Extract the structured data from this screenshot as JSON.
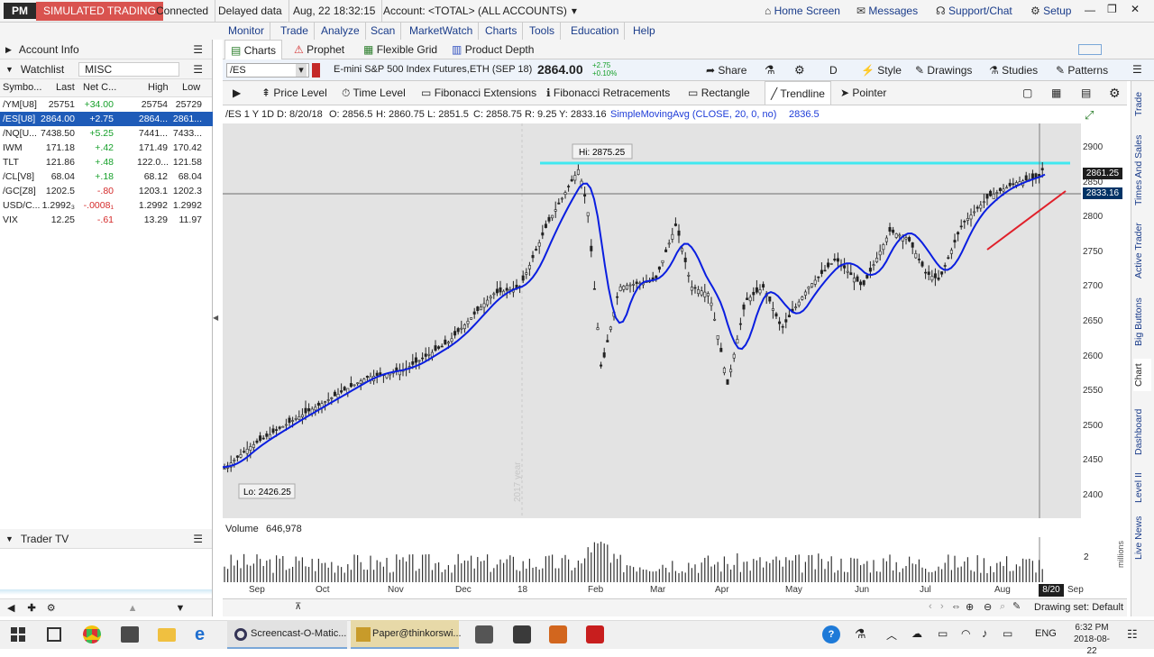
{
  "titlebar": {
    "logo": "PM",
    "mode": "SIMULATED TRADING",
    "status": "Connected",
    "data_mode": "Delayed data",
    "datetime": "Aug, 22  18:32:15",
    "account": "Account: <TOTAL> (ALL ACCOUNTS)",
    "home": "Home Screen",
    "messages": "Messages",
    "support": "Support/Chat",
    "setup": "Setup"
  },
  "menu": [
    "Monitor",
    "Trade",
    "Analyze",
    "Scan",
    "MarketWatch",
    "Charts",
    "Tools",
    "Education",
    "Help"
  ],
  "leftpanel": {
    "account_info": "Account Info",
    "watchlist_label": "Watchlist",
    "watchlist_name": "MISC",
    "columns": [
      "Symbo...",
      "Last",
      "Net C...",
      "High",
      "Low"
    ],
    "rows": [
      {
        "sym": "/YM[U8]",
        "last": "25751",
        "net": "+34.00",
        "high": "25754",
        "low": "25729",
        "dir": "pos"
      },
      {
        "sym": "/ES[U8]",
        "last": "2864.00",
        "net": "+2.75",
        "high": "2864...",
        "low": "2861...",
        "dir": "pos"
      },
      {
        "sym": "/NQ[U...",
        "last": "7438.50",
        "net": "+5.25",
        "high": "7441...",
        "low": "7433...",
        "dir": "pos"
      },
      {
        "sym": "IWM",
        "last": "171.18",
        "net": "+.42",
        "high": "171.49",
        "low": "170.42",
        "dir": "pos"
      },
      {
        "sym": "TLT",
        "last": "121.86",
        "net": "+.48",
        "high": "122.0...",
        "low": "121.58",
        "dir": "pos"
      },
      {
        "sym": "/CL[V8]",
        "last": "68.04",
        "net": "+.18",
        "high": "68.12",
        "low": "68.04",
        "dir": "pos"
      },
      {
        "sym": "/GC[Z8]",
        "last": "1202.5",
        "net": "-.80",
        "high": "1203.1",
        "low": "1202.3",
        "dir": "neg"
      },
      {
        "sym": "USD/C...",
        "last": "1.2992₃",
        "net": "-.0008₁",
        "high": "1.2992",
        "low": "1.2992",
        "dir": "neg"
      },
      {
        "sym": "VIX",
        "last": "12.25",
        "net": "-.61",
        "high": "13.29",
        "low": "11.97",
        "dir": "neg"
      }
    ],
    "trader_tv": "Trader TV"
  },
  "chart": {
    "tabs": [
      "Charts",
      "Prophet",
      "Flexible Grid",
      "Product Depth"
    ],
    "symbol": "/ES",
    "description": "E-mini S&P 500 Index Futures,ETH (SEP 18)",
    "price": "2864.00",
    "change": "+2.75",
    "change_pct": "+0.10%",
    "share": "Share",
    "period": "D",
    "style": "Style",
    "drawings": "Drawings",
    "studies": "Studies",
    "patterns": "Patterns",
    "tools": [
      "Price Level",
      "Time Level",
      "Fibonacci Extensions",
      "Fibonacci Retracements",
      "Rectangle",
      "Trendline",
      "Pointer"
    ],
    "info": {
      "label": "/ES 1 Y 1D",
      "date": "D: 8/20/18",
      "open": "O: 2856.5",
      "high": "H: 2860.75",
      "low": "L: 2851.5",
      "close": "C: 2858.75",
      "range": "R: 9.25",
      "y": "Y: 2833.16",
      "sma": "SimpleMovingAvg (CLOSE, 20, 0, no)",
      "sma_val": "2836.5"
    },
    "hi_label": "Hi: 2875.25",
    "lo_label": "Lo: 2426.25",
    "year_label": "2017 year",
    "price_ticks": [
      "2900",
      "2850",
      "2800",
      "2750",
      "2700",
      "2650",
      "2600",
      "2550",
      "2500",
      "2450",
      "2400"
    ],
    "price_tag": "2861.25",
    "cursor_tag": "2833.16",
    "volume_label": "Volume",
    "volume_value": "646,978",
    "vol_tick": "2",
    "vol_unit": "millions",
    "time_ticks": [
      "Sep",
      "Oct",
      "Nov",
      "Dec",
      "18",
      "Feb",
      "Mar",
      "Apr",
      "May",
      "Jun",
      "Jul",
      "Aug",
      "Sep"
    ],
    "time_tag": "8/20",
    "drawing_set": "Drawing set: Default",
    "colors": {
      "sma": "#0a1ee0",
      "hi_line": "#40e8f0",
      "trendline": "#e0202a",
      "candle": "#222222",
      "cursor_tag": "#003366"
    }
  },
  "side_tabs": [
    "Trade",
    "Times And Sales",
    "Active Trader",
    "Big Buttons",
    "Chart",
    "Dashboard",
    "Level II",
    "Live News"
  ],
  "taskbar": {
    "app1": "Screencast-O-Matic...",
    "app2": "Paper@thinkorswi...",
    "lang": "ENG",
    "time": "6:32 PM",
    "date": "2018-08-22"
  }
}
